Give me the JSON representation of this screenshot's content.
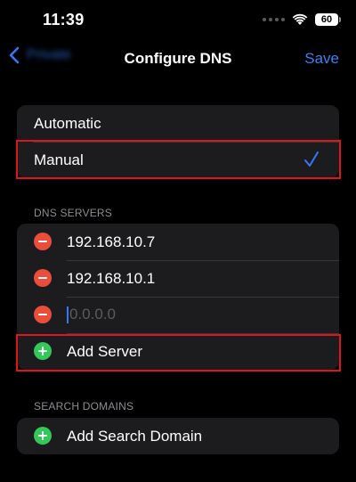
{
  "status_bar": {
    "time": "11:39",
    "battery": "60",
    "wifi_icon": "wifi-icon"
  },
  "nav": {
    "back_label": "Private",
    "title": "Configure DNS",
    "save_label": "Save",
    "back_icon": "chevron-left-icon"
  },
  "mode": {
    "options": [
      {
        "label": "Automatic",
        "selected": false
      },
      {
        "label": "Manual",
        "selected": true
      }
    ],
    "checkmark_icon": "checkmark-icon"
  },
  "dns_servers": {
    "header": "DNS SERVERS",
    "servers": [
      "192.168.10.7",
      "192.168.10.1"
    ],
    "new_server_placeholder": "0.0.0.0",
    "add_label": "Add Server"
  },
  "search_domains": {
    "header": "SEARCH DOMAINS",
    "add_label": "Add Search Domain"
  },
  "colors": {
    "accent": "#3478f6",
    "remove": "#eb4d3d",
    "add": "#34c759",
    "highlight": "#e0141b"
  }
}
